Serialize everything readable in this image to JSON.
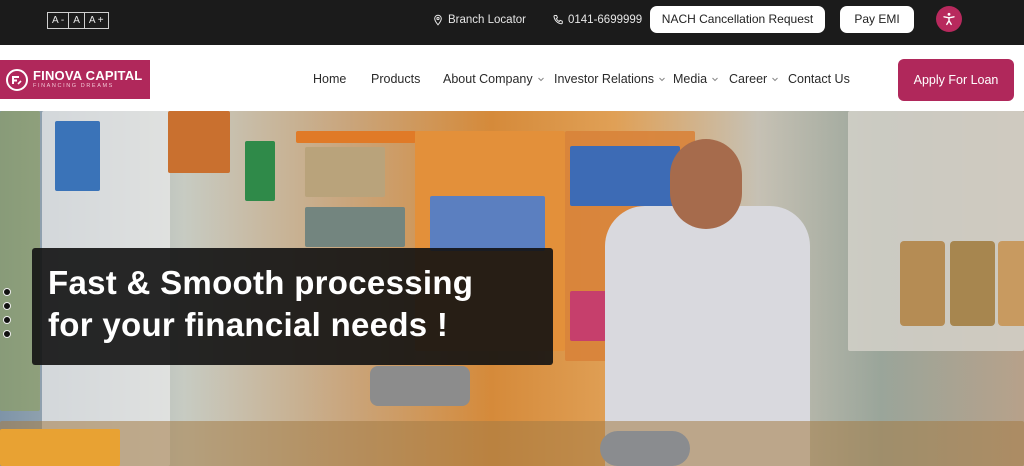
{
  "topbar": {
    "font_controls": [
      "A -",
      "A",
      "A +"
    ],
    "branch_locator": "Branch Locator",
    "phone": "0141-6699999",
    "nach_button": "NACH Cancellation Request",
    "pay_emi_button": "Pay EMI",
    "accessibility_icon": "accessibility-icon"
  },
  "logo": {
    "name": "FINOVA CAPITAL",
    "tagline": "FINANCING DREAMS"
  },
  "nav": {
    "items": [
      {
        "label": "Home",
        "dropdown": false
      },
      {
        "label": "Products",
        "dropdown": false
      },
      {
        "label": "About Company",
        "dropdown": true
      },
      {
        "label": "Investor Relations",
        "dropdown": true
      },
      {
        "label": "Media",
        "dropdown": true
      },
      {
        "label": "Career",
        "dropdown": true
      },
      {
        "label": "Contact Us",
        "dropdown": false
      }
    ],
    "apply_button": "Apply For Loan"
  },
  "hero": {
    "caption_line1": "Fast & Smooth processing",
    "caption_line2": "for your financial needs !",
    "slides": 4,
    "active_slide": 1
  },
  "colors": {
    "brand": "#b0285b",
    "topbar": "#1b1b1b"
  }
}
